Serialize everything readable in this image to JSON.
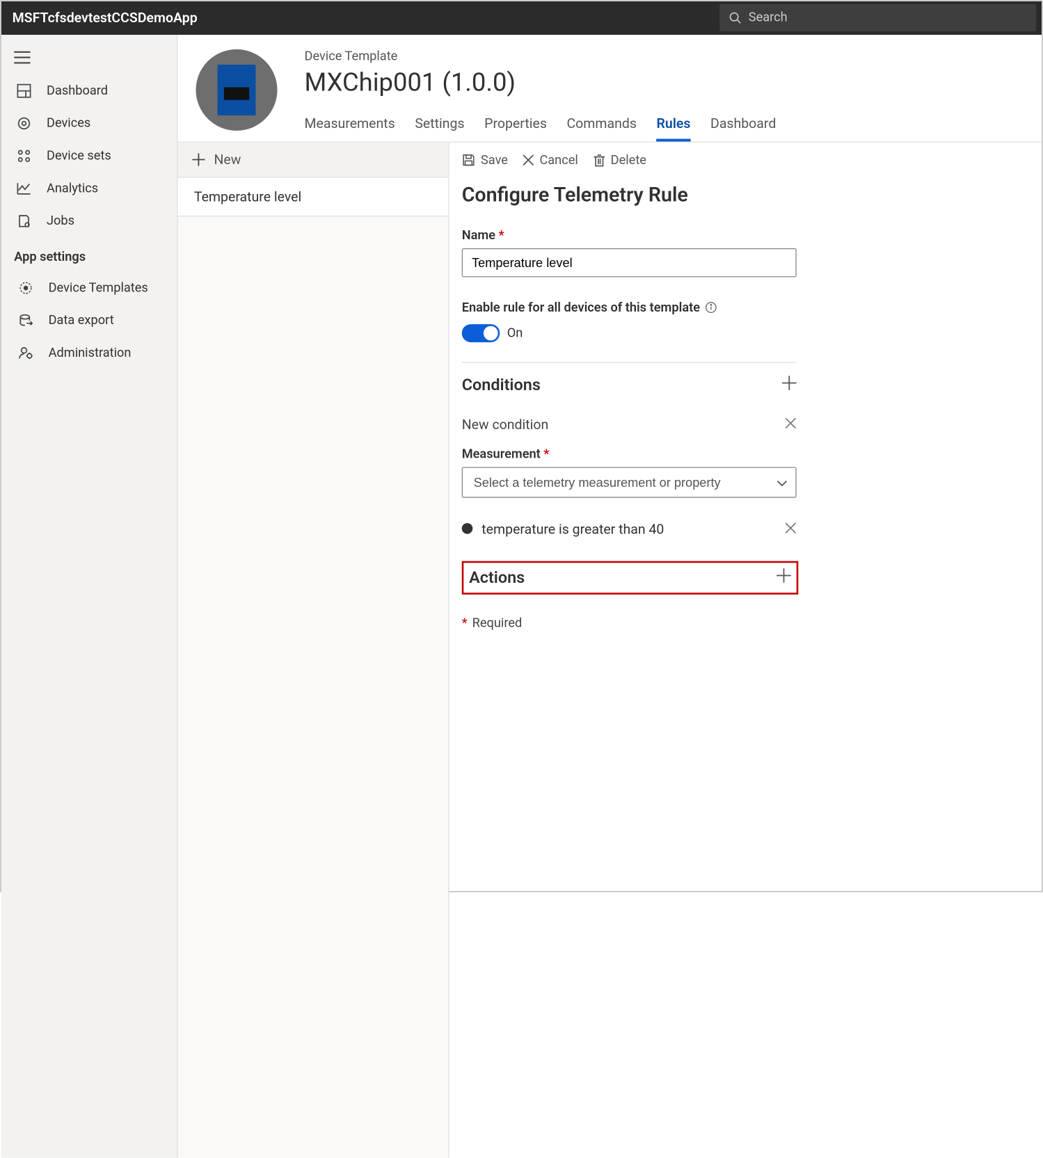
{
  "app_title": "MSFTcfsdevtestCCSDemoApp",
  "search_placeholder": "Search",
  "sidebar": {
    "items": [
      {
        "label": "Dashboard"
      },
      {
        "label": "Devices"
      },
      {
        "label": "Device sets"
      },
      {
        "label": "Analytics"
      },
      {
        "label": "Jobs"
      }
    ],
    "group_label": "App settings",
    "group_items": [
      {
        "label": "Device Templates"
      },
      {
        "label": "Data export"
      },
      {
        "label": "Administration"
      }
    ]
  },
  "header": {
    "breadcrumb": "Device Template",
    "title": "MXChip001  (1.0.0)",
    "tabs": [
      "Measurements",
      "Settings",
      "Properties",
      "Commands",
      "Rules",
      "Dashboard"
    ],
    "active_tab": "Rules"
  },
  "rules_list": {
    "new_label": "New",
    "items": [
      "Temperature level"
    ]
  },
  "commands": {
    "save": "Save",
    "cancel": "Cancel",
    "delete": "Delete"
  },
  "rule_form": {
    "title": "Configure Telemetry Rule",
    "name_label": "Name",
    "name_value": "Temperature level",
    "enable_label": "Enable rule for all devices of this template",
    "enable_state": "On",
    "conditions_label": "Conditions",
    "new_condition": "New condition",
    "measurement_label": "Measurement",
    "measurement_placeholder": "Select a telemetry measurement or property",
    "existing_condition": "temperature is greater than 40",
    "actions_label": "Actions",
    "required_note": "Required"
  }
}
